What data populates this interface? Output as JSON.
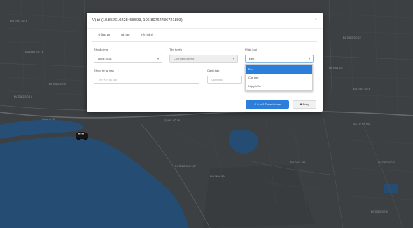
{
  "modal": {
    "title": "Vị trí (10.852610228468593, 106.80764436721803)",
    "close_glyph": "×"
  },
  "tabs": [
    {
      "label": "Thông tin",
      "active": true
    },
    {
      "label": "Tai nạn",
      "active": false
    },
    {
      "label": "Hình ảnh",
      "active": false
    }
  ],
  "form": {
    "road_name": {
      "label": "Tên đường",
      "value": "Quốc lộ 1K"
    },
    "route_name": {
      "label": "Tên tuyến",
      "value": "Chọn tên đường"
    },
    "classification": {
      "label": "Phân loại",
      "value": "Đen"
    },
    "accident_location": {
      "label": "Tên vị trí tai nạn",
      "placeholder": "Tên vị trí tai nạn"
    },
    "warning": {
      "label": "Cảnh báo",
      "placeholder": "Cảnh báo"
    },
    "caret_glyph": "▾"
  },
  "dropdown": {
    "options": [
      {
        "label": "Đen",
        "selected": true
      },
      {
        "label": "Cận đen",
        "selected": false
      },
      {
        "label": "Nguy hiểm",
        "selected": false
      }
    ]
  },
  "buttons": {
    "save_label": "✔ Lưu & Thêm tai nạn",
    "close_label": "✖ Đóng"
  },
  "colors": {
    "accent": "#2b7ed9",
    "map_land": "#4a4f52",
    "map_water": "#2e5f8e"
  },
  "map_labels": [
    "ĐƯỜNG SỐ 16",
    "ĐƯỜNG SỐ 9",
    "ĐƯỜNG SỐ 18",
    "ĐƯỜNG SỐ 22",
    "Quốc lộ 1K",
    "QUỐC LỘ 1K",
    "XA LỘ HÀ NỘI",
    "LÊ VĂN VIỆT",
    "ĐƯỜNG SỐ 4",
    "ĐƯỜNG SỐ 8",
    "PHÚ NHUẬN",
    "ĐƯỜNG 385",
    "ĐƯỜNG TÂN LẬP",
    "ĐƯỜNG SỐ 3",
    "ĐƯỜNG SỐ 5"
  ]
}
